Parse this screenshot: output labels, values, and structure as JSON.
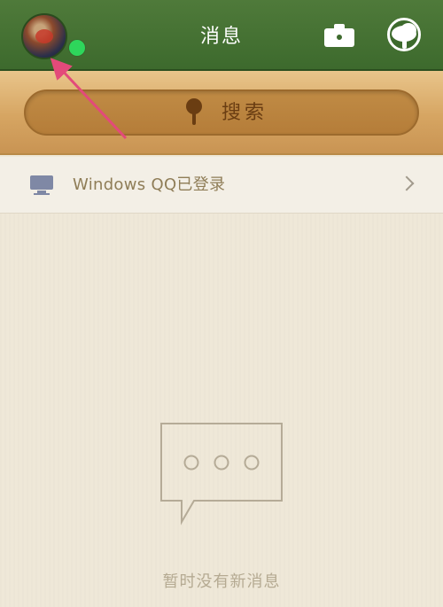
{
  "header": {
    "title": "消息",
    "avatar_icon": "avatar-icon",
    "online_status_color": "#2ed65b",
    "camera_icon": "camera-icon",
    "plus_icon": "tree-logo-icon"
  },
  "search": {
    "label": "搜索",
    "icon": "pin-icon"
  },
  "qq_login": {
    "text": "Windows QQ已登录",
    "icon": "computer-icon",
    "chevron_icon": "chevron-right-icon"
  },
  "empty_state": {
    "text": "暂时没有新消息",
    "icon": "message-bubble-icon"
  },
  "colors": {
    "header_green": "#3d6a2d",
    "wood": "#d6a562",
    "paper": "#efe8d8",
    "arrow": "#e34a7a"
  }
}
